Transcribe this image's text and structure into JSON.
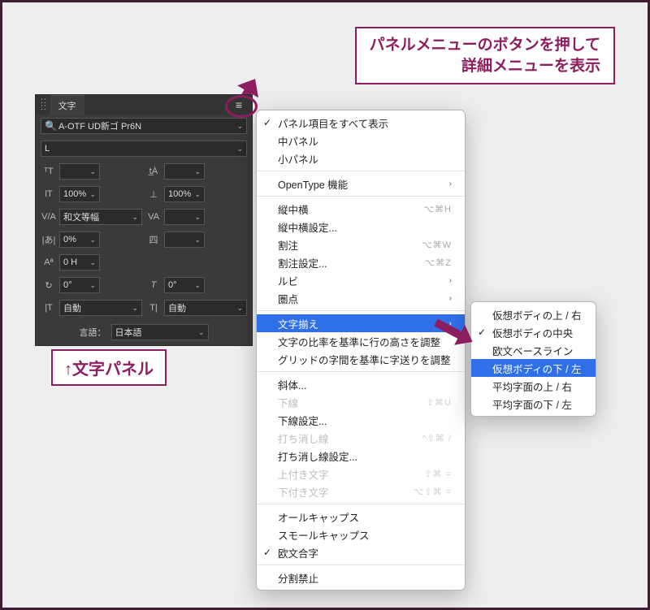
{
  "callouts": {
    "top_line1": "パネルメニューのボタンを押して",
    "top_line2": "詳細メニューを表示",
    "bottom": "↑文字パネル"
  },
  "panel": {
    "tab": "文字",
    "font_name": "A-OTF UD新ゴ Pr6N",
    "font_style": "L",
    "hscale": "100%",
    "vscale": "100%",
    "kerning": "和文等幅",
    "tracking_pct": "0%",
    "aki": "0 H",
    "rotation": "0°",
    "skew": "0°",
    "auto1": "自動",
    "auto2": "自動",
    "lang_label": "言語：",
    "lang_value": "日本語"
  },
  "menu": {
    "items": [
      {
        "label": "パネル項目をすべて表示",
        "check": true
      },
      {
        "label": "中パネル"
      },
      {
        "label": "小パネル"
      },
      {
        "sep": true
      },
      {
        "label": "OpenType 機能",
        "sub": true
      },
      {
        "sep": true
      },
      {
        "label": "縦中横",
        "shortcut": "⌥⌘H"
      },
      {
        "label": "縦中横設定..."
      },
      {
        "label": "割注",
        "shortcut": "⌥⌘W"
      },
      {
        "label": "割注設定...",
        "shortcut": "⌥⌘Z"
      },
      {
        "label": "ルビ",
        "sub": true
      },
      {
        "label": "圏点",
        "sub": true
      },
      {
        "sep": true
      },
      {
        "label": "文字揃え",
        "sub": true,
        "highlight": true
      },
      {
        "label": "文字の比率を基準に行の高さを調整"
      },
      {
        "label": "グリッドの字間を基準に字送りを調整"
      },
      {
        "sep": true
      },
      {
        "label": "斜体..."
      },
      {
        "label": "下線",
        "shortcut": "⇧⌘U",
        "disabled": true
      },
      {
        "label": "下線設定..."
      },
      {
        "label": "打ち消し線",
        "shortcut": "^⇧⌘ /",
        "disabled": true
      },
      {
        "label": "打ち消し線設定..."
      },
      {
        "label": "上付き文字",
        "shortcut": "⇧⌘ =",
        "disabled": true
      },
      {
        "label": "下付き文字",
        "shortcut": "⌥⇧⌘ =",
        "disabled": true
      },
      {
        "sep": true
      },
      {
        "label": "オールキャップス"
      },
      {
        "label": "スモールキャップス"
      },
      {
        "label": "欧文合字",
        "check": true
      },
      {
        "sep": true
      },
      {
        "label": "分割禁止"
      }
    ]
  },
  "submenu": {
    "items": [
      {
        "label": "仮想ボディの上 / 右"
      },
      {
        "label": "仮想ボディの中央",
        "check": true
      },
      {
        "label": "欧文ベースライン"
      },
      {
        "label": "仮想ボディの下 / 左",
        "highlight": true
      },
      {
        "label": "平均字面の上 / 右"
      },
      {
        "label": "平均字面の下 / 左"
      }
    ]
  }
}
